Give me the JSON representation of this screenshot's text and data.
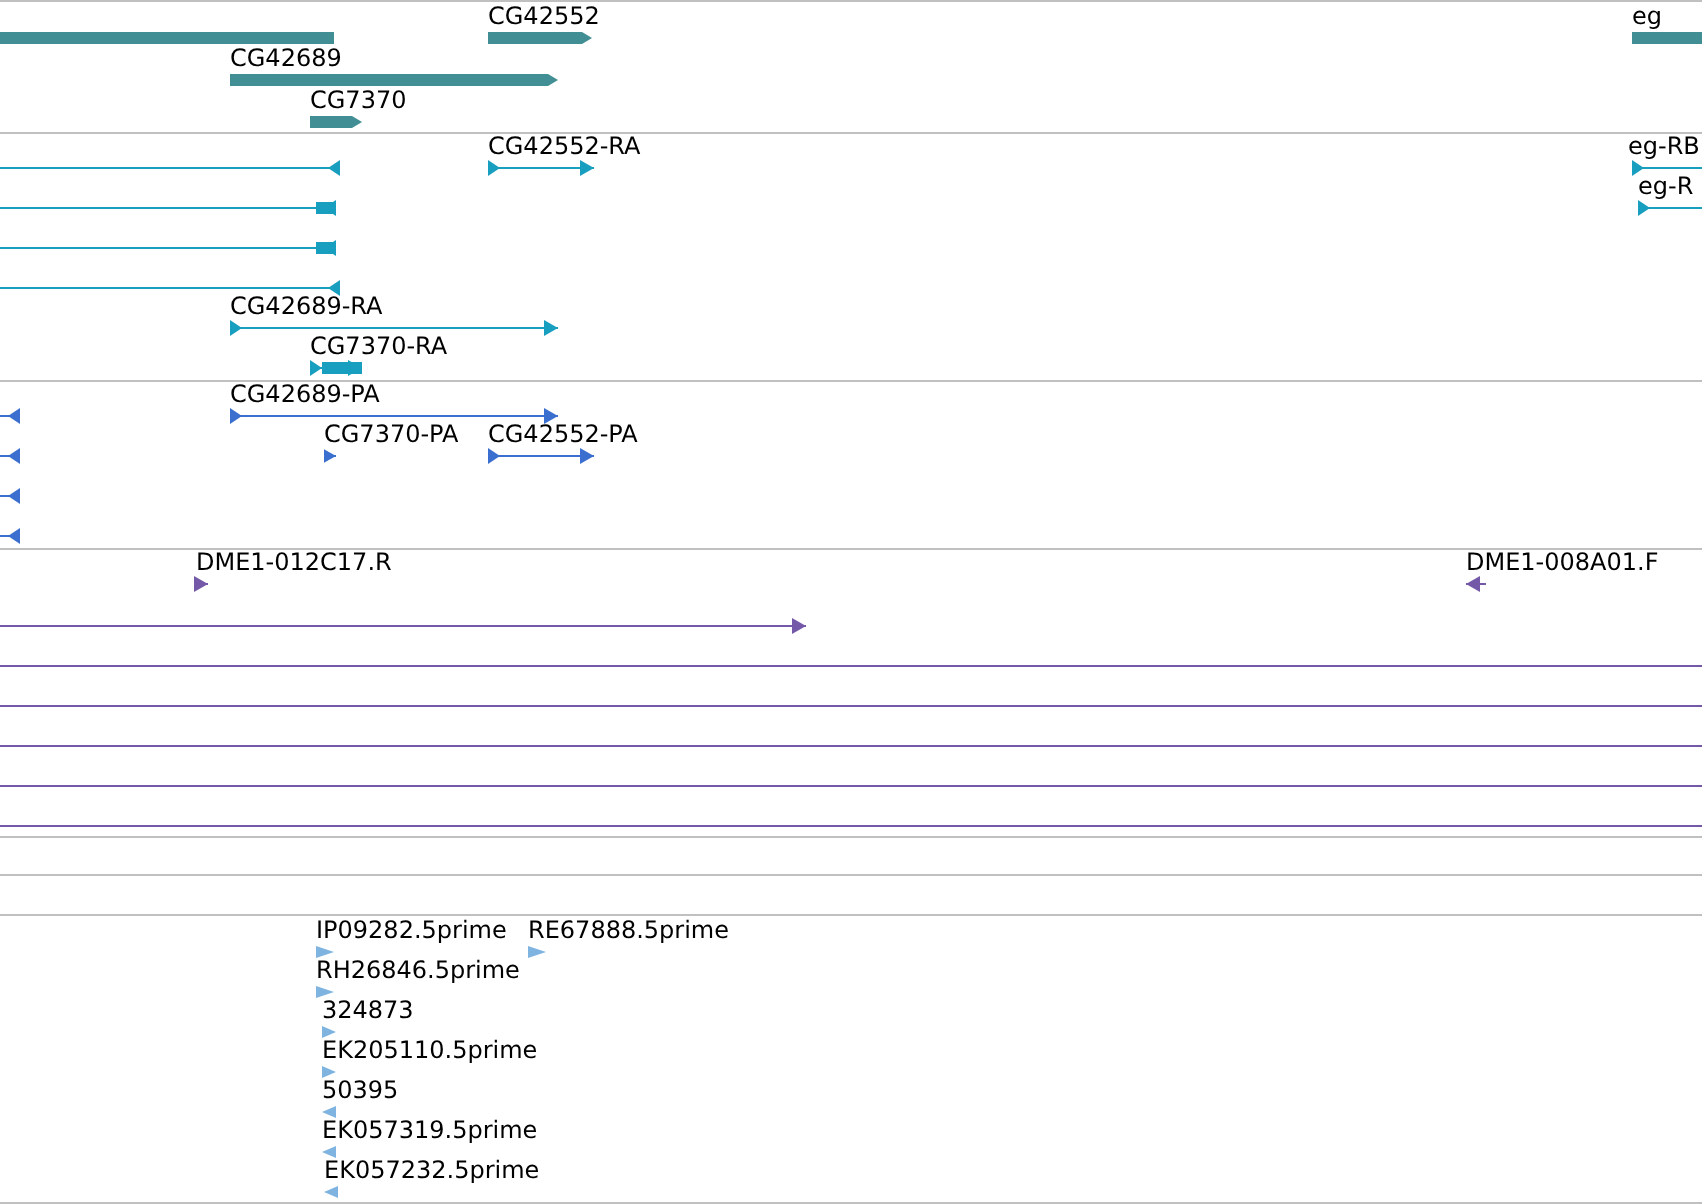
{
  "tracks": [
    {
      "kind": "gene",
      "features": [
        {
          "reverse": true
        },
        {
          "label": "CG42552",
          "reverse": false
        },
        {
          "label": "CG42689",
          "reverse": false
        },
        {
          "label": "CG7370",
          "reverse": false
        },
        {
          "label": "eg",
          "reverse": false
        }
      ]
    },
    {
      "kind": "transcript",
      "features": [
        {
          "reverse": true
        },
        {
          "reverse": true
        },
        {
          "reverse": true
        },
        {
          "reverse": true
        },
        {
          "label": "CG42552-RA",
          "reverse": false
        },
        {
          "label": "CG42689-RA",
          "reverse": false
        },
        {
          "label": "CG7370-RA",
          "reverse": false
        },
        {
          "label": "eg-RB",
          "reverse": false
        },
        {
          "label": "eg-R",
          "reverse": false
        }
      ]
    },
    {
      "kind": "protein",
      "features": [
        {
          "reverse": true
        },
        {
          "reverse": true
        },
        {
          "reverse": true
        },
        {
          "reverse": true
        },
        {
          "label": "CG42689-PA",
          "reverse": false
        },
        {
          "label": "CG7370-PA",
          "reverse": false
        },
        {
          "label": "CG42552-PA",
          "reverse": false
        }
      ]
    },
    {
      "kind": "alignment",
      "features": [
        {
          "kind": "read",
          "label": "DME1-012C17.R",
          "reverse": false
        },
        {
          "kind": "read",
          "label": "DME1-008A01.F",
          "reverse": true
        },
        {
          "kind": "read",
          "reverse": false
        },
        {
          "kind": "span"
        },
        {
          "kind": "span"
        },
        {
          "kind": "span"
        },
        {
          "kind": "span"
        },
        {
          "kind": "span"
        }
      ]
    },
    {
      "kind": "est",
      "features": [
        {
          "label": "IP09282.5prime",
          "reverse": false
        },
        {
          "label": "RE67888.5prime",
          "reverse": false
        },
        {
          "label": "RH26846.5prime",
          "reverse": false
        },
        {
          "label": "324873",
          "reverse": false
        },
        {
          "label": "EK205110.5prime",
          "reverse": false
        },
        {
          "label": "50395",
          "reverse": true
        },
        {
          "label": "EK057319.5prime",
          "reverse": true
        },
        {
          "label": "EK057232.5prime",
          "reverse": true
        }
      ]
    }
  ]
}
